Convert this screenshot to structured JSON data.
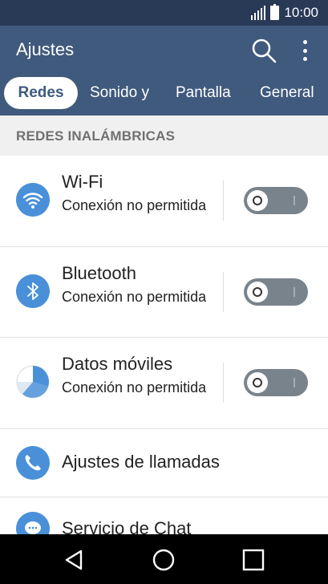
{
  "status_bar": {
    "time": "10:00"
  },
  "app": {
    "title": "Ajustes"
  },
  "tabs": [
    {
      "label": "Redes"
    },
    {
      "label": "Sonido y"
    },
    {
      "label": "Pantalla"
    },
    {
      "label": "General"
    }
  ],
  "section": {
    "title": "REDES INALÁMBRICAS"
  },
  "settings": [
    {
      "title": "Wi-Fi",
      "subtitle": "Conexión no permitida",
      "toggle_on": false,
      "icon": "wifi-icon"
    },
    {
      "title": "Bluetooth",
      "subtitle": "Conexión no permitida",
      "toggle_on": false,
      "icon": "bluetooth-icon"
    },
    {
      "title": "Datos móviles",
      "subtitle": "Conexión no permitida",
      "toggle_on": false,
      "icon": "mobile-data-icon"
    },
    {
      "title": "Ajustes de llamadas",
      "icon": "phone-icon"
    },
    {
      "title": "Servicio de Chat",
      "icon": "chat-icon"
    }
  ],
  "colors": {
    "status_bar": "#293a57",
    "app_bar": "#3f5a7c",
    "accent_icon": "#4a90d9",
    "toggle_off": "#79838b"
  }
}
